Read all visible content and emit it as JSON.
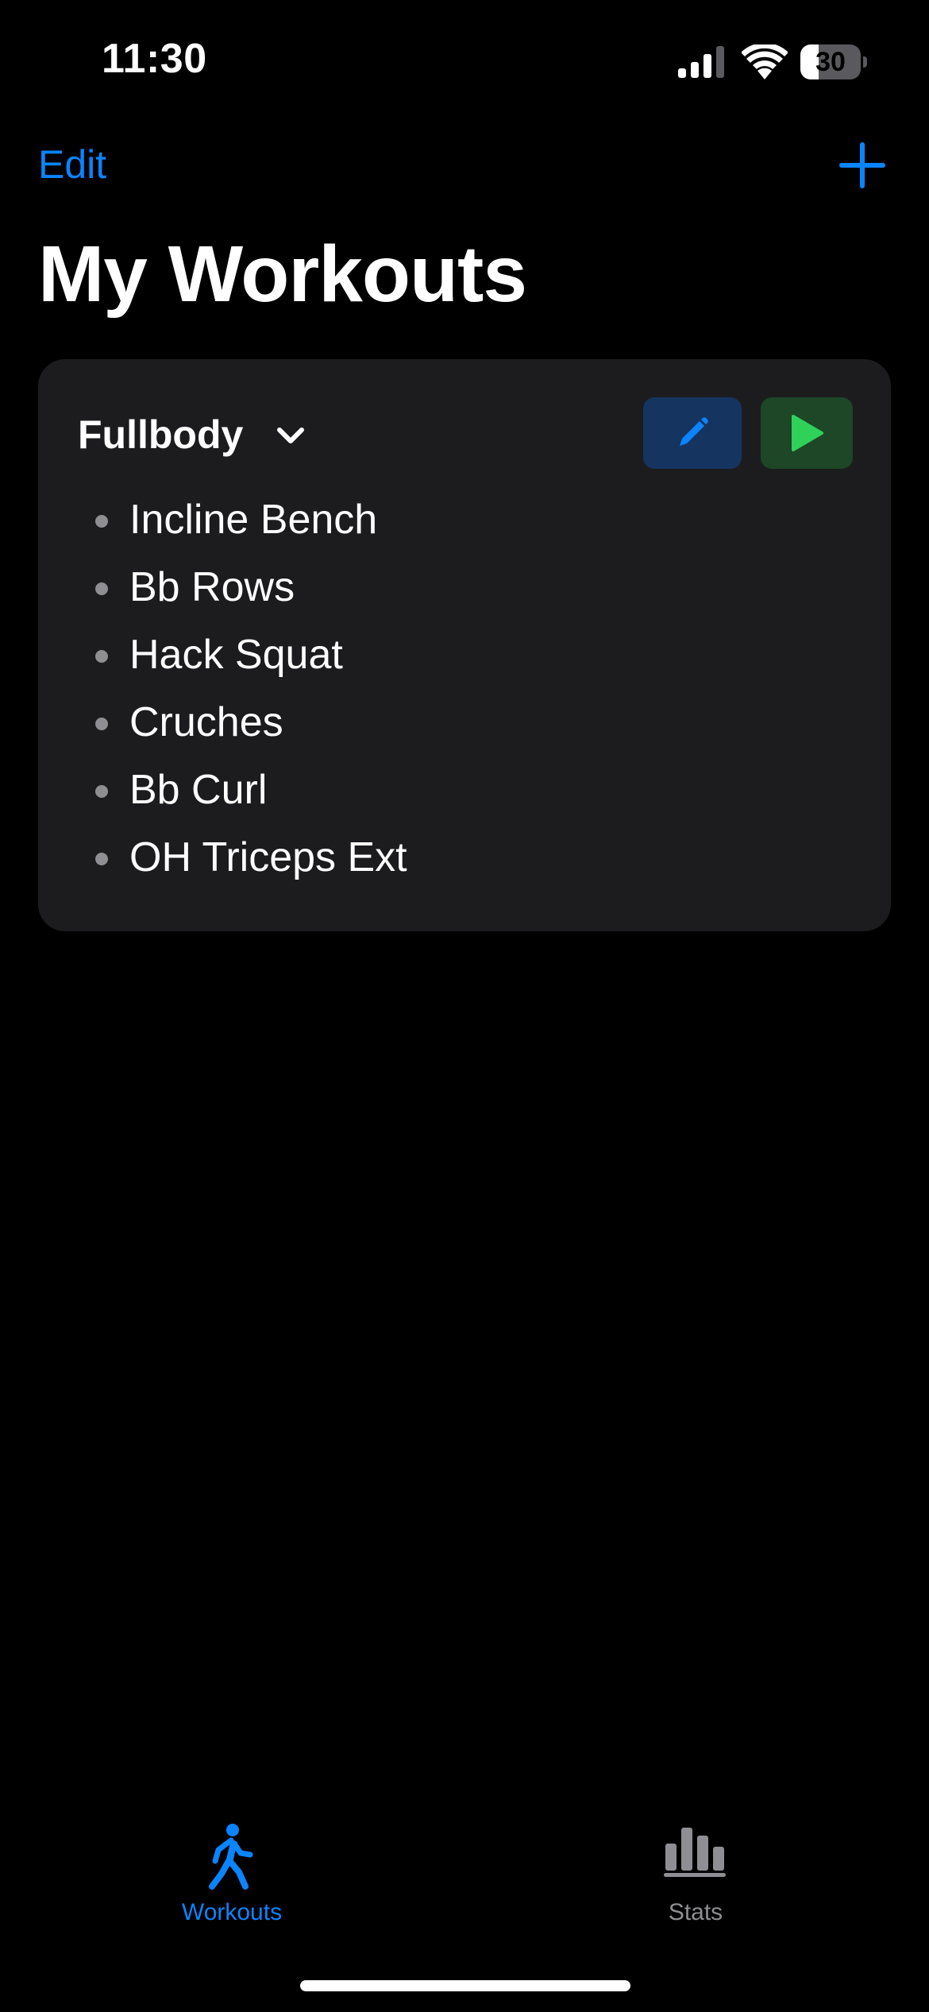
{
  "status_bar": {
    "time": "11:30",
    "battery_level": "30",
    "battery_fraction": 0.3
  },
  "nav": {
    "edit_label": "Edit",
    "add_icon": "plus-icon",
    "title": "My Workouts"
  },
  "workout": {
    "name": "Fullbody",
    "exercises": [
      "Incline Bench",
      "Bb Rows",
      "Hack Squat",
      "Cruches",
      "Bb Curl",
      "OH Triceps Ext"
    ]
  },
  "tab_bar": {
    "tabs": [
      {
        "label": "Workouts",
        "icon": "walking-figure-icon",
        "selected": true
      },
      {
        "label": "Stats",
        "icon": "bar-chart-icon",
        "selected": false
      }
    ]
  },
  "colors": {
    "accent": "#0a84ff",
    "play": "#30d158",
    "card": "#1c1c1e",
    "background": "#000000"
  }
}
